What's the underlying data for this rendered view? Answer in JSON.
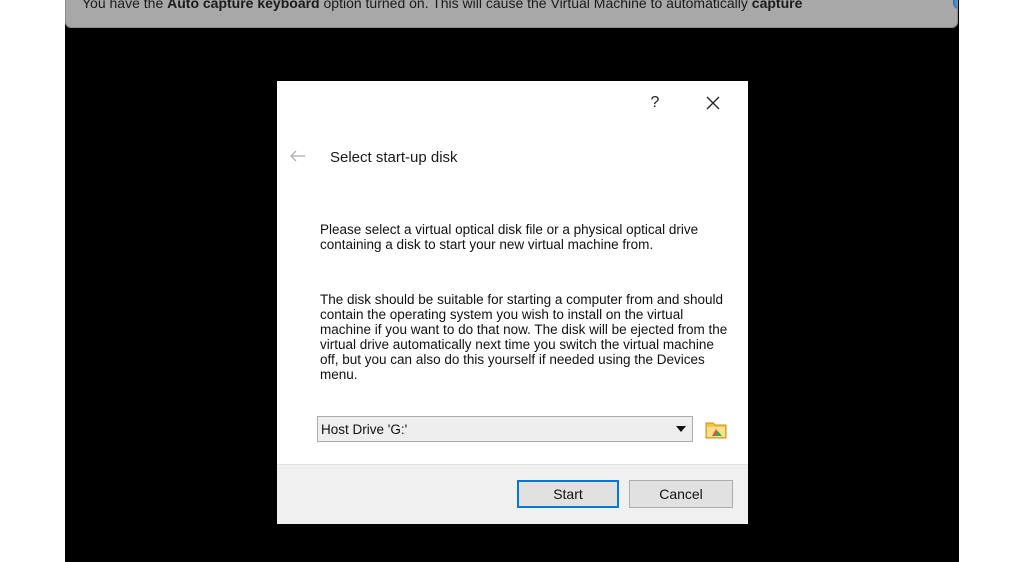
{
  "notification": {
    "text_before": "You have the ",
    "option_name": "Auto capture keyboard",
    "text_middle": " option turned on. This will cause the Virtual Machine to automatically ",
    "action": "capture",
    "info_icon": "info-icon",
    "close_icon": "close-icon"
  },
  "dialog": {
    "help_label": "?",
    "close_icon": "close-icon",
    "back_icon": "back-arrow-icon",
    "title": "Select start-up disk",
    "description_1": "Please select a virtual optical disk file or a physical optical drive containing a disk to start your new virtual machine from.",
    "description_2": "The disk should be suitable for starting a computer from and should contain the operating system you wish to install on the virtual machine if you want to do that now. The disk will be ejected from the virtual drive automatically next time you switch the virtual machine off, but you can also do this yourself if needed using the Devices menu.",
    "disk_selector": {
      "selected": "Host Drive 'G:'"
    },
    "folder_icon": "folder-icon",
    "buttons": {
      "start": "Start",
      "cancel": "Cancel"
    }
  }
}
